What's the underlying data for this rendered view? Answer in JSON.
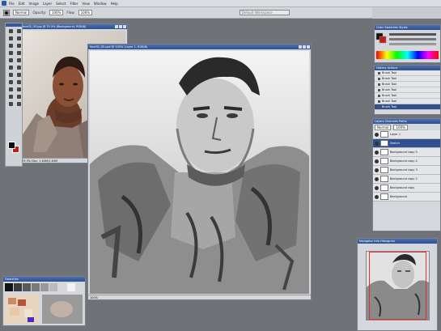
{
  "menubar": {
    "items": [
      "File",
      "Edit",
      "Image",
      "Layer",
      "Select",
      "Filter",
      "View",
      "Window",
      "Help"
    ]
  },
  "options": {
    "mode_value": "Normal",
    "opacity_label": "Opacity:",
    "opacity_value": "100%",
    "flow_label": "Flow:",
    "flow_value": "100%",
    "workspace_placeholder": "Brushes",
    "workspace_value": "Default Workspace"
  },
  "ref_window": {
    "title": "face02_03.jpg @ 33.3% (Background, RGB/8)",
    "status": "33.3%  Doc: 1.64M/1.64M"
  },
  "main_window": {
    "title": "face02_05.psd @ 100% (Layer 1, RGB/8)",
    "status": "100%"
  },
  "swatches_window": {
    "title": "Swatches"
  },
  "color_window": {
    "title": "Color   Swatches   Styles"
  },
  "history_window": {
    "title": "History   Actions",
    "items": [
      "Brush Tool",
      "Brush Tool",
      "Brush Tool",
      "Brush Tool",
      "Brush Tool",
      "Brush Tool",
      "Brush Tool"
    ]
  },
  "layers_window": {
    "title": "Layers   Channels   Paths",
    "blend_mode": "Normal",
    "opacity": "100%",
    "layers": [
      {
        "name": "Layer 1",
        "active": false
      },
      {
        "name": "Sketch",
        "active": true
      },
      {
        "name": "Background copy 5",
        "active": false
      },
      {
        "name": "Background copy 4",
        "active": false
      },
      {
        "name": "Background copy 3",
        "active": false
      },
      {
        "name": "Background copy 2",
        "active": false
      },
      {
        "name": "Background copy",
        "active": false
      },
      {
        "name": "Background",
        "active": false
      }
    ]
  },
  "navigator_window": {
    "title": "Navigator   Info   Histogram"
  },
  "colors": {
    "foreground": "#111111",
    "background": "#c41b1b",
    "title_bar": "#2f4f8f"
  }
}
